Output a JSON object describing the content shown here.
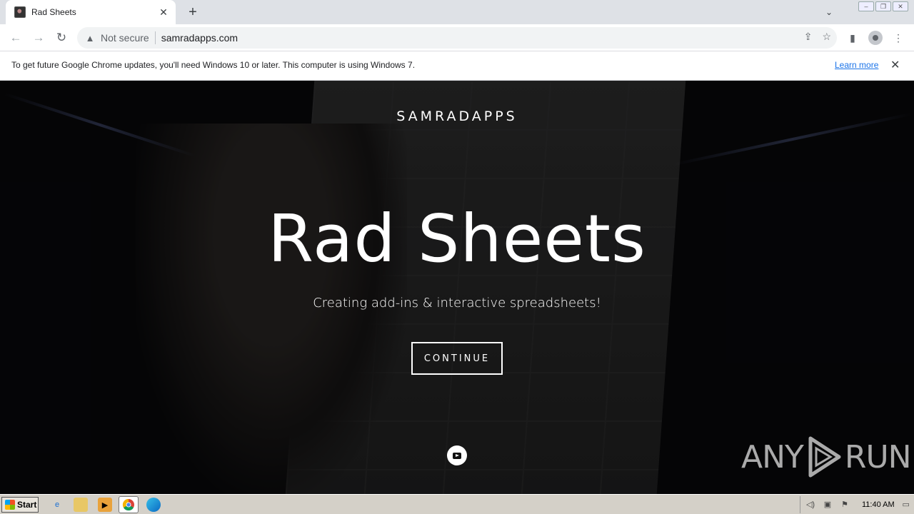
{
  "browser": {
    "tab_title": "Rad Sheets",
    "new_tab_symbol": "+",
    "security_label": "Not secure",
    "url": "samradapps.com"
  },
  "infobar": {
    "message": "To get future Google Chrome updates, you'll need Windows 10 or later. This computer is using Windows 7.",
    "link": "Learn more"
  },
  "page": {
    "brand": "SAMRADAPPS",
    "title": "Rad Sheets",
    "subtitle": "Creating add-ins & interactive spreadsheets!",
    "cta_label": "CONTINUE",
    "social_icon": "youtube-icon"
  },
  "watermark": {
    "left_text": "ANY",
    "right_text": "RUN"
  },
  "taskbar": {
    "start_label": "Start",
    "clock": "11:40 AM"
  },
  "colors": {
    "link": "#1a73e8",
    "page_background": "#0a0a0c",
    "taskbar": "#d4d0c8"
  }
}
